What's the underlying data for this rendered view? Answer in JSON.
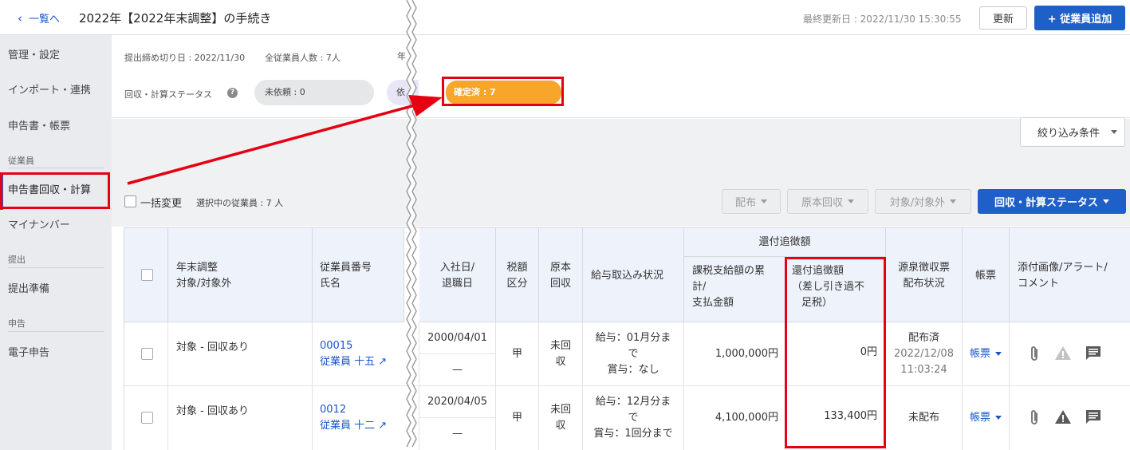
{
  "header": {
    "back_label": "一覧へ",
    "title": "2022年【2022年末調整】の手続き",
    "last_updated": "最終更新日 : 2022/11/30 15:30:55",
    "refresh_label": "更新",
    "add_employee_label": "+ 従業員追加"
  },
  "sidebar": {
    "management": "管理・設定",
    "import": "インポート・連携",
    "forms": "申告書・帳票",
    "employee_header": "従業員",
    "collect_calc": "申告書回収・計算",
    "my_number": "マイナンバー",
    "submit_header": "提出",
    "submit_prep": "提出準備",
    "declare_header": "申告",
    "e_filing": "電子申告"
  },
  "info": {
    "deadline": "提出締め切り日 : 2022/11/30",
    "total_employees": "全従業員人数 : 7人",
    "year_fragment": "年",
    "status_label": "回収・計算ステータス",
    "help_icon_glyph": "?",
    "pill_unrequested": "未依頼 : 0",
    "pill_requested_fragment": "依",
    "pill_confirmed": "確定済 : 7"
  },
  "toolbar": {
    "filter_label": "絞り込み条件",
    "bulk_change": "一括変更",
    "selected_count": "選択中の従業員 : 7 人",
    "distribute": "配布",
    "original_collect": "原本回収",
    "target": "対象/対象外",
    "status_button": "回収・計算ステータス"
  },
  "table": {
    "headers": {
      "year_end_target_l1": "年末調整",
      "year_end_target_l2": "対象/対象外",
      "emp_no_l1": "従業員番号",
      "emp_no_l2": "氏名",
      "join_l1": "入社日/",
      "join_l2": "退職日",
      "tax_l1": "税額",
      "tax_l2": "区分",
      "original_l1": "原本",
      "original_l2": "回収",
      "payroll": "給与取込み状況",
      "refund_group": "還付追徴額",
      "taxable_l1": "課税支給額の累",
      "taxable_l2": "計/",
      "taxable_l3": "支払金額",
      "refund_l1": "還付追徴額",
      "refund_l2": "（差し引き過不",
      "refund_l3": "足税）",
      "withholding_l1": "源泉徴収票",
      "withholding_l2": "配布状況",
      "forms": "帳票",
      "attach_l1": "添付画像/アラート/",
      "attach_l2": "コメント"
    },
    "rows": [
      {
        "target": "対象 - 回収あり",
        "emp_no": "00015",
        "name": "従業員 十五",
        "join_date": "2000/04/01",
        "leave_date": "—",
        "tax_class": "甲",
        "original_l1": "未回",
        "original_l2": "収",
        "payroll_l1": "給与：01月分ま",
        "payroll_l2": "で",
        "payroll_l3": "賞与：なし",
        "taxable": "1,000,000円",
        "refund": "0円",
        "withholding_status": "配布済",
        "withholding_date": "2022/12/08",
        "withholding_time": "11:03:24",
        "forms_link": "帳票"
      },
      {
        "target": "対象 - 回収あり",
        "emp_no": "0012",
        "name": "従業員 十二",
        "join_date": "2020/04/05",
        "leave_date": "—",
        "tax_class": "甲",
        "original_l1": "未回",
        "original_l2": "収",
        "payroll_l1": "給与：12月分ま",
        "payroll_l2": "で",
        "payroll_l3": "賞与：1回分まで",
        "taxable": "4,100,000円",
        "refund": "133,400円",
        "withholding_status": "未配布",
        "forms_link": "帳票"
      }
    ]
  },
  "colors": {
    "primary": "#1f5fc8",
    "confirmed": "#f7a52b",
    "highlight": "#e60012"
  },
  "icons": {
    "back": "chevron-left-icon",
    "help": "question-circle-icon",
    "attach": "paperclip-icon",
    "alert": "warning-triangle-icon",
    "comment": "comment-icon"
  }
}
